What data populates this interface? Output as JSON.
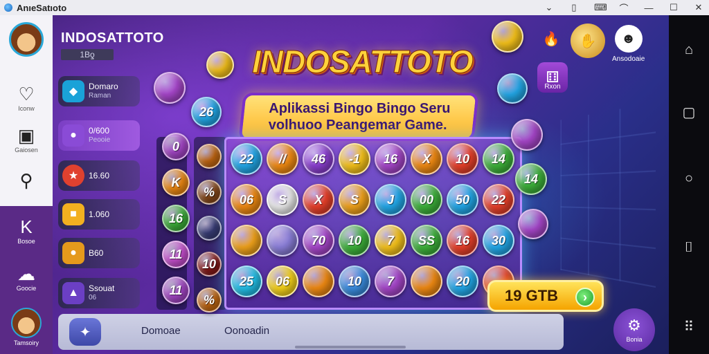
{
  "window": {
    "title": "AnıeSatıoto",
    "icons": [
      "chevron-down-icon",
      "lock-icon",
      "keyboard-icon",
      "wifi-icon",
      "minimize-icon",
      "maximize-icon",
      "close-icon"
    ]
  },
  "sidebar": {
    "items": [
      {
        "label": "Iconw",
        "icon": "heart-icon"
      },
      {
        "label": "Gaiosen",
        "icon": "store-icon"
      },
      {
        "label": "",
        "icon": "search-icon"
      },
      {
        "label": "Bosoe",
        "icon": "k-icon"
      },
      {
        "label": "Goocie",
        "icon": "cloud-icon"
      }
    ],
    "footer_label": "Tamsoiry"
  },
  "brand": {
    "name": "INDOSATTOTO",
    "sub": "1Bƍ"
  },
  "menu_cards": [
    {
      "main": "Domaro",
      "sub": "Raman",
      "color": "#1aa2d8",
      "glyph": "◆"
    },
    {
      "main": "0/600",
      "sub": "Peooie",
      "color": "#8a4bd6",
      "glyph": "●"
    },
    {
      "main": "16.60",
      "sub": "",
      "color": "#e0412f",
      "glyph": "★"
    },
    {
      "main": "1.060",
      "sub": "",
      "color": "#f2b020",
      "glyph": "■"
    },
    {
      "main": "B60",
      "sub": "",
      "color": "#e59a1c",
      "glyph": "●"
    },
    {
      "main": "Ssouat",
      "sub": "06",
      "color": "#6b3fc4",
      "glyph": "▲"
    }
  ],
  "game": {
    "title": "INDOSATTOTO",
    "subtitle_line1": "Aplikassi Bingo Bingo Seru",
    "subtitle_line2": "volhuoo Peangemar Game."
  },
  "board_balls": [
    [
      "22",
      "//",
      "46",
      "-1",
      "16",
      "X",
      "10",
      "14"
    ],
    [
      "06",
      "S",
      "X",
      "S",
      "J",
      "00",
      "50",
      "22"
    ],
    [
      "",
      "",
      "70",
      "10",
      "7",
      "SS",
      "16",
      "30"
    ],
    [
      "25",
      "06",
      "",
      "10",
      "7",
      "",
      "20",
      ""
    ]
  ],
  "board_colors": [
    [
      "#22a8e8",
      "#f08a12",
      "#8b3fd0",
      "#f5c21a",
      "#a646c9",
      "#f08a12",
      "#e8402a",
      "#3db23a"
    ],
    [
      "#f08a12",
      "#e9e9e9",
      "#e8402a",
      "#f0a21a",
      "#22a8e8",
      "#3db23a",
      "#22a8e8",
      "#e8402a"
    ],
    [
      "#f0a21a",
      "#8a7ed8",
      "#a646c9",
      "#3db23a",
      "#f5c21a",
      "#3db23a",
      "#e8402a",
      "#22a8e8"
    ],
    [
      "#22c0e8",
      "#f5d21a",
      "#f08a12",
      "#3a8de0",
      "#a646c9",
      "#f08a12",
      "#22a8e8",
      "#e8402a"
    ]
  ],
  "side_balls_left": [
    {
      "label": "0",
      "color": "#a646c9"
    },
    {
      "label": "K",
      "color": "#f08a12"
    },
    {
      "label": "16",
      "color": "#3db23a"
    },
    {
      "label": "11",
      "color": "#c84fd0"
    },
    {
      "label": "11",
      "color": "#a646c9"
    }
  ],
  "side_balls_dark": [
    {
      "label": "",
      "color": "#c86a12"
    },
    {
      "label": "%",
      "color": "#8a4a1a"
    },
    {
      "label": "",
      "color": "#3a3f7a"
    },
    {
      "label": "10",
      "color": "#8a1a1a"
    },
    {
      "label": "%",
      "color": "#c86a12"
    }
  ],
  "right_balls": [
    {
      "label": "",
      "color": "#a646c9"
    },
    {
      "label": "14",
      "color": "#3db23a"
    },
    {
      "label": "",
      "color": "#a646c9"
    }
  ],
  "floating_balls": [
    {
      "label": "",
      "color": "#f5c21a"
    },
    {
      "label": "26",
      "color": "#22a8e8"
    },
    {
      "label": "",
      "color": "#a646c9"
    },
    {
      "label": "",
      "color": "#f5c21a"
    },
    {
      "label": "",
      "color": "#22a8e8"
    }
  ],
  "prize": {
    "amount": "19 GTB"
  },
  "top_right": [
    {
      "label": "",
      "icon": "fire-icon"
    },
    {
      "label": "",
      "icon": "coin-icon"
    },
    {
      "label": "Ansodoaie",
      "icon": "avatar-icon"
    }
  ],
  "dice_badge": {
    "label": "Rxon"
  },
  "bottom_nav": {
    "left_label": "Domoae",
    "right_label": "Oonoadin",
    "corner_label": "Bonia"
  }
}
